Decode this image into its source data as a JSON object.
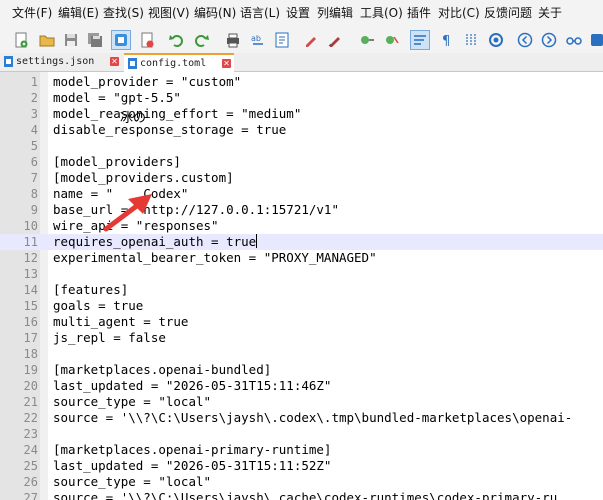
{
  "menu": [
    "文件(F)",
    "编辑(E)",
    "查找(S)",
    "视图(V)",
    "编码(N)",
    "语言(L)",
    "设置",
    "列编辑",
    "工具(O)",
    "插件",
    "对比(C)",
    "反馈问题",
    "关于"
  ],
  "toolbar_icons": [
    "new-file-icon",
    "open-file-icon",
    "save-icon",
    "save-all-icon",
    "close-icon",
    "close-all-icon",
    "undo-icon",
    "redo-icon",
    "print-icon",
    "find-icon",
    "replace-icon",
    "zoom-in-icon",
    "zoom-out-icon",
    "cut-icon",
    "paste-icon",
    "wrap-icon",
    "show-all-chars-icon",
    "indent-guide-icon",
    "macro-record-icon",
    "macro-back-icon",
    "macro-forward-icon",
    "macro-play-icon",
    "macro-save-icon"
  ],
  "tabs": [
    {
      "label": "settings.json",
      "close": "✕"
    },
    {
      "label": "config.toml",
      "close": "✕"
    }
  ],
  "annotation": {
    "text": "冰の",
    "color": "#e53935"
  },
  "colors": {
    "accent_tab": "#f0a030",
    "current_line": "#e8e8ff",
    "close_button": "#e04848"
  },
  "lines": [
    {
      "num": "1",
      "text": "model_provider = \"custom\""
    },
    {
      "num": "2",
      "text": "model = \"gpt-5.5\""
    },
    {
      "num": "3",
      "text": "model_reasoning_effort = \"medium\""
    },
    {
      "num": "4",
      "text": "disable_response_storage = true"
    },
    {
      "num": "5",
      "text": ""
    },
    {
      "num": "6",
      "text": "[model_providers]"
    },
    {
      "num": "7",
      "text": "[model_providers.custom]"
    },
    {
      "num": "8",
      "text": "name = \"    Codex\""
    },
    {
      "num": "9",
      "text": "base_url = \"http://127.0.0.1:15721/v1\""
    },
    {
      "num": "10",
      "text": "wire_api = \"responses\""
    },
    {
      "num": "11",
      "text": "requires_openai_auth = true"
    },
    {
      "num": "12",
      "text": "experimental_bearer_token = \"PROXY_MANAGED\""
    },
    {
      "num": "13",
      "text": ""
    },
    {
      "num": "14",
      "text": "[features]"
    },
    {
      "num": "15",
      "text": "goals = true"
    },
    {
      "num": "16",
      "text": "multi_agent = true"
    },
    {
      "num": "17",
      "text": "js_repl = false"
    },
    {
      "num": "18",
      "text": ""
    },
    {
      "num": "19",
      "text": "[marketplaces.openai-bundled]"
    },
    {
      "num": "20",
      "text": "last_updated = \"2026-05-31T15:11:46Z\""
    },
    {
      "num": "21",
      "text": "source_type = \"local\""
    },
    {
      "num": "22",
      "text": "source = '\\\\?\\C:\\Users\\jaysh\\.codex\\.tmp\\bundled-marketplaces\\openai-"
    },
    {
      "num": "23",
      "text": ""
    },
    {
      "num": "24",
      "text": "[marketplaces.openai-primary-runtime]"
    },
    {
      "num": "25",
      "text": "last_updated = \"2026-05-31T15:11:52Z\""
    },
    {
      "num": "26",
      "text": "source_type = \"local\""
    },
    {
      "num": "27",
      "text": "source = '\\\\?\\C:\\Users\\jaysh\\.cache\\codex-runtimes\\codex-primary-ru"
    }
  ]
}
